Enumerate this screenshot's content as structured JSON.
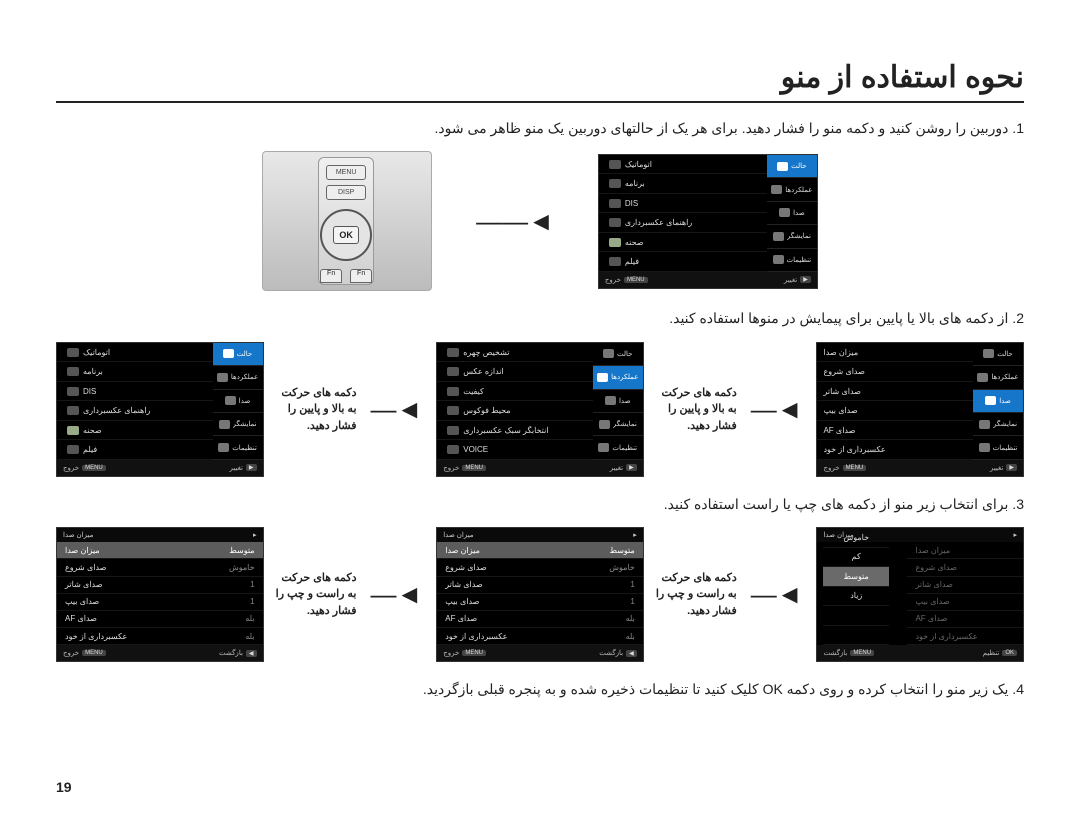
{
  "page_number": "19",
  "title": "نحوه استفاده از منو",
  "steps": {
    "s1": "1. دوربین را روشن کنید و دکمه منو را فشار دهید. برای هر یک از حالتهای دوربین یک منو ظاهر می شود.",
    "s2": "2. از دکمه های بالا یا پایین برای پیمایش در منوها استفاده کنید.",
    "s3": "3. برای انتخاب زیر منو از دکمه های چپ یا راست استفاده کنید.",
    "s4": "4. یک زیر منو را انتخاب کرده و روی دکمه OK کلیک کنید تا تنظیمات ذخیره شده و به پنجره قبلی بازگردید."
  },
  "captions": {
    "ud": "دکمه های حرکت به بالا و پایین را فشار دهید.",
    "lr": "دکمه های حرکت به راست و چپ را فشار دهید."
  },
  "camera": {
    "menu": "MENU",
    "disp": "DISP",
    "ok": "OK",
    "fn1": "Fn",
    "fn2": "Fn"
  },
  "side_tabs": [
    "حالت",
    "عملکردها",
    "صدا",
    "نمایشگر",
    "تنظیمات"
  ],
  "mode_list": [
    "اتوماتیک",
    "برنامه",
    "DIS",
    "راهنمای عکسبرداری",
    "صحنه",
    "فیلم"
  ],
  "func_list": [
    "تشخیص چهره",
    "اندازه عکس",
    "کیفیت",
    "محیط فوکوس",
    "انتخابگر سبک عکسبرداری",
    "VOICE"
  ],
  "sound_list": [
    "میزان صدا",
    "صدای شروع",
    "صدای شاتر",
    "صدای بیپ",
    "صدای AF",
    "عکسبرداری از خود"
  ],
  "sound_header": "میزان صدا",
  "sound_rows": [
    {
      "k": "میزان صدا",
      "v": "متوسط"
    },
    {
      "k": "صدای شروع",
      "v": "خاموش"
    },
    {
      "k": "صدای شاتر",
      "v": "1"
    },
    {
      "k": "صدای بیپ",
      "v": "1"
    },
    {
      "k": "صدای AF",
      "v": "بله"
    },
    {
      "k": "عکسبرداری از خود",
      "v": "بله"
    }
  ],
  "vol_options": [
    "خاموش",
    "کم",
    "متوسط",
    "زیاد"
  ],
  "bar": {
    "menu": "MENU",
    "ok": "OK",
    "exit": "خروج",
    "change": "تغییر",
    "back": "بازگشت",
    "set": "تنظیم"
  }
}
